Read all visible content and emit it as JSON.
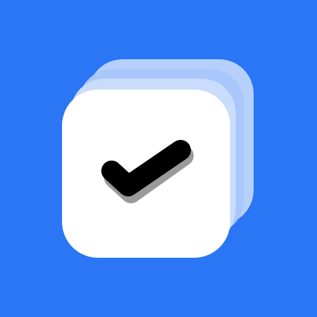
{
  "icon": {
    "name": "stacked-checkmark-app-icon",
    "colors": {
      "background": "#2A76F5",
      "card_back": "#B6D0FB",
      "card_middle": "#C9DCFC",
      "card_rear_mid": "#A9C7FA",
      "card_front": "#FFFFFF",
      "checkmark": "#000000",
      "checkmark_shadow": "#9A9A9A"
    }
  }
}
